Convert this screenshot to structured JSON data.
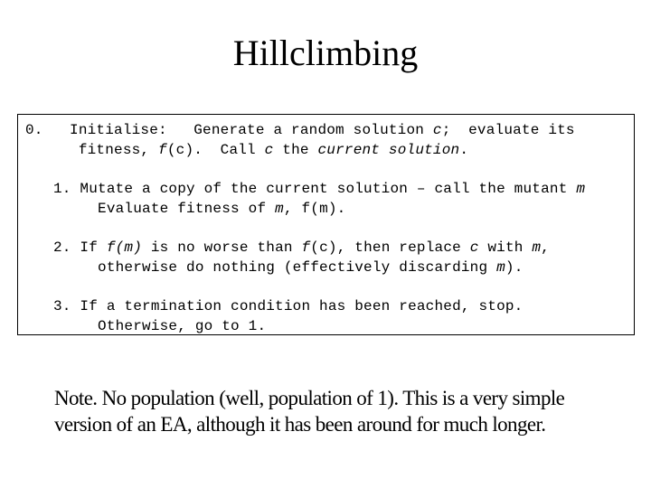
{
  "title": "Hillclimbing",
  "steps": [
    {
      "number": "0.",
      "lines": [
        [
          {
            "text": "   Initialise:   Generate a random solution ",
            "italic": false
          },
          {
            "text": "c",
            "italic": true
          },
          {
            "text": ";  evaluate its",
            "italic": false
          }
        ],
        [
          {
            "text": "    fitness, ",
            "italic": false
          },
          {
            "text": "f",
            "italic": true
          },
          {
            "text": "(c).  Call ",
            "italic": false
          },
          {
            "text": "c",
            "italic": true
          },
          {
            "text": " the ",
            "italic": false
          },
          {
            "text": "current solution",
            "italic": true
          },
          {
            "text": ".",
            "italic": false
          }
        ]
      ]
    },
    {
      "number": "1.",
      "lines": [
        [
          {
            "text": " Mutate a copy of the current solution – call the mutant ",
            "italic": false
          },
          {
            "text": "m",
            "italic": true
          }
        ],
        [
          {
            "text": "   Evaluate fitness of ",
            "italic": false
          },
          {
            "text": "m",
            "italic": true
          },
          {
            "text": ", f(m).",
            "italic": false
          }
        ]
      ]
    },
    {
      "number": "2.",
      "lines": [
        [
          {
            "text": " If ",
            "italic": false
          },
          {
            "text": "f(m)",
            "italic": true
          },
          {
            "text": " is no worse than ",
            "italic": false
          },
          {
            "text": "f",
            "italic": true
          },
          {
            "text": "(c), then replace ",
            "italic": false
          },
          {
            "text": "c",
            "italic": true
          },
          {
            "text": " with ",
            "italic": false
          },
          {
            "text": "m",
            "italic": true
          },
          {
            "text": ",",
            "italic": false
          }
        ],
        [
          {
            "text": "   otherwise do nothing (effectively discarding ",
            "italic": false
          },
          {
            "text": "m",
            "italic": true
          },
          {
            "text": ").",
            "italic": false
          }
        ]
      ]
    },
    {
      "number": "3.",
      "lines": [
        [
          {
            "text": " If a termination condition has been reached, stop.",
            "italic": false
          }
        ],
        [
          {
            "text": "   Otherwise, go to 1.",
            "italic": false
          }
        ]
      ]
    }
  ],
  "note": {
    "lines": [
      "Note. No population (well, population of 1). This is a very simple",
      "version of an EA, although it has been around for much longer."
    ]
  }
}
